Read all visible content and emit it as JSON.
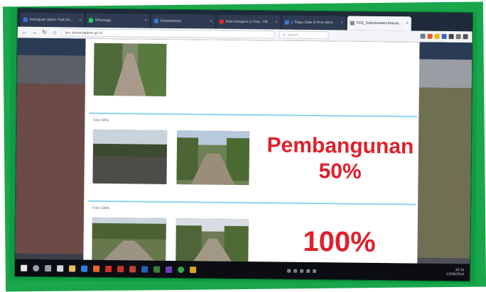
{
  "browser": {
    "tabs": [
      {
        "label": "Kemajuan dalam Fisik Bd...",
        "color": "#3b6fd8"
      },
      {
        "label": "Whatsapp",
        "color": "#25d366"
      },
      {
        "label": "Dokumentasi",
        "color": "#3a7bd5"
      },
      {
        "label": "Kola Kamponi Lt Foto - FB",
        "color": "#e0262f"
      },
      {
        "label": "L Tinjau Data di Prov Akhir",
        "color": "#3a7bd5"
      },
      {
        "label": "FDC_Dokumentasi Kekurangan",
        "color": "#888888",
        "active": true
      }
    ],
    "url": "kec.desarutapbee.go.id",
    "search_placeholder": "Q. Search"
  },
  "content": {
    "section_1_label": "Foto 50%",
    "section_2_label": "Foto 100%",
    "progress_1_line1": "Pembangunan",
    "progress_1_line2": "50%",
    "progress_2": "100%"
  },
  "taskbar": {
    "time": "10:15",
    "date": "12/06/2019"
  },
  "colors": {
    "frame_green": "#1aa64a",
    "accent_red": "#e0202a",
    "divider_blue": "#8dd3ee"
  }
}
